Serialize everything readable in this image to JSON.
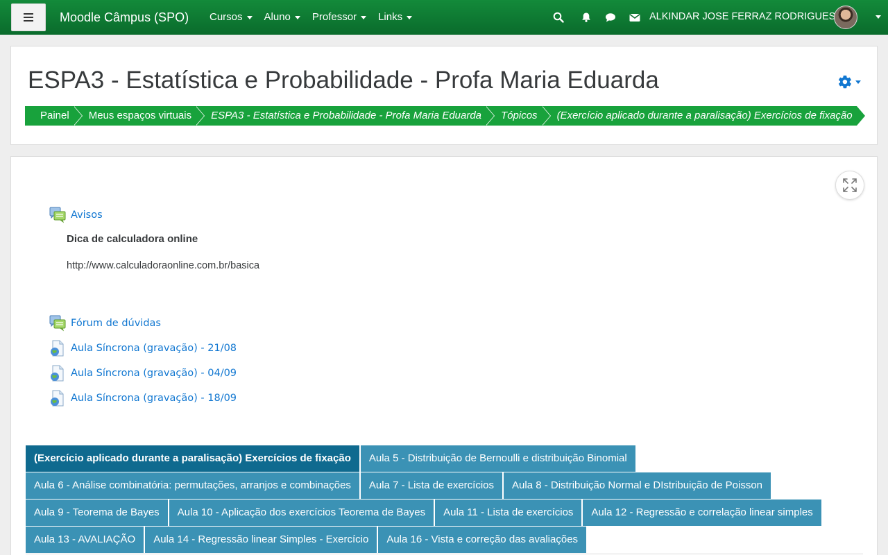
{
  "navbar": {
    "brand": "Moodle Câmpus (SPO)",
    "menus": [
      {
        "label": "Cursos"
      },
      {
        "label": "Aluno"
      },
      {
        "label": "Professor"
      },
      {
        "label": "Links"
      }
    ],
    "user_name": "ALKINDAR JOSE FERRAZ RODRIGUES",
    "colors": {
      "bar": "#0a6b2c"
    }
  },
  "header": {
    "title": "ESPA3 - Estatística e Probabilidade - Profa Maria Eduarda",
    "breadcrumb": [
      "Painel",
      "Meus espaços virtuais",
      "ESPA3 - Estatística e Probabilidade - Profa Maria Eduarda",
      "Tópicos",
      "(Exercício aplicado durante a paralisação) Exercícios de fixação"
    ]
  },
  "content": {
    "announcements_link": "Avisos",
    "post_title": "Dica de calculadora online",
    "post_url": "http://www.calculadoraonline.com.br/basica",
    "activities": [
      "Fórum de dúvidas",
      "Aula Síncrona (gravação) - 21/08",
      "Aula Síncrona (gravação) - 04/09",
      "Aula Síncrona (gravação) - 18/09"
    ],
    "tabs": [
      [
        "(Exercício aplicado durante a paralisação) Exercícios de fixação",
        "Aula 5 - Distribuição de Bernoulli e distribuição Binomial"
      ],
      [
        "Aula 6 - Análise combinatória: permutações, arranjos e combinações",
        "Aula 7 - Lista de exercícios",
        "Aula 8 - Distribuição Normal e DIstribuição de Poisson"
      ],
      [
        "Aula 9 - Teorema de Bayes",
        "Aula 10 - Aplicação dos exercícios Teorema de Bayes",
        "Aula 11 - Lista de exercícios",
        "Aula 12 - Regressão e correlação linear simples"
      ],
      [
        "Aula 13 - AVALIAÇÃO",
        "Aula 14 - Regressão linear Simples - Exercício",
        "Aula 16 - Vista e correção das avaliações"
      ]
    ],
    "colors": {
      "tab": "#3b92b5",
      "tab_active": "#0f6a8f",
      "link": "#1177d1"
    }
  }
}
